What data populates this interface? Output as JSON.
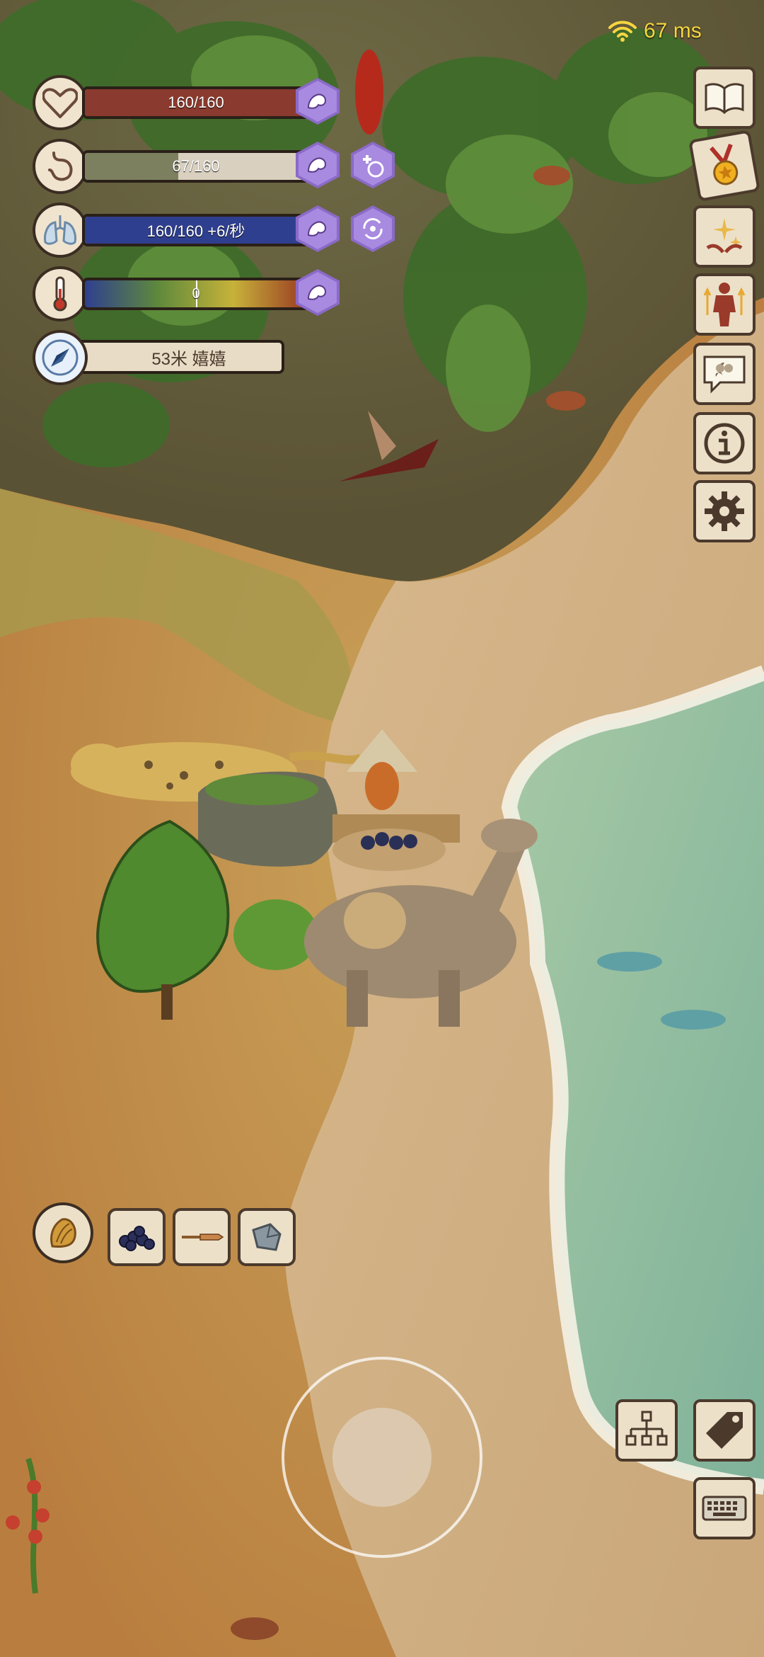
{
  "network": {
    "latency": "67 ms",
    "icon": "wifi-icon",
    "color": "#f6d640"
  },
  "stats": {
    "health": {
      "icon": "heart-icon",
      "text": "160/160",
      "fill": 1.0,
      "color": "#8a3a2e"
    },
    "hunger": {
      "icon": "stomach-icon",
      "text": "67/160",
      "fill": 0.42,
      "color": "#7d805f"
    },
    "breath": {
      "icon": "lungs-icon",
      "text": "160/160 +6/秒",
      "fill": 1.0,
      "color": "#2f3f8f"
    },
    "temperature": {
      "icon": "thermometer-icon",
      "text": "0",
      "fill": 0.5
    },
    "compass": {
      "icon": "compass-icon",
      "text": "53米 嬉嬉"
    }
  },
  "buffs": [
    {
      "icon": "muscle-arm-icon"
    },
    {
      "icon": "muscle-arm-icon"
    },
    {
      "icon": "muscle-arm-icon"
    },
    {
      "icon": "muscle-arm-icon"
    },
    {
      "icon": "plus-buff-icon"
    },
    {
      "icon": "regen-cycle-icon"
    }
  ],
  "side_menu": [
    {
      "name": "book-icon"
    },
    {
      "name": "medal-icon"
    },
    {
      "name": "sparkle-hands-icon"
    },
    {
      "name": "body-upgrade-icon"
    },
    {
      "name": "chat-bubble-icon"
    },
    {
      "name": "info-icon"
    },
    {
      "name": "settings-gear-icon"
    }
  ],
  "inventory": [
    {
      "icon": "hay-bundle-icon"
    },
    {
      "icon": "berries-icon"
    },
    {
      "icon": "knife-icon"
    },
    {
      "icon": "stone-icon"
    }
  ],
  "bottom_controls": [
    {
      "icon": "tech-tree-icon"
    },
    {
      "icon": "tag-icon"
    },
    {
      "icon": "keyboard-icon"
    }
  ]
}
